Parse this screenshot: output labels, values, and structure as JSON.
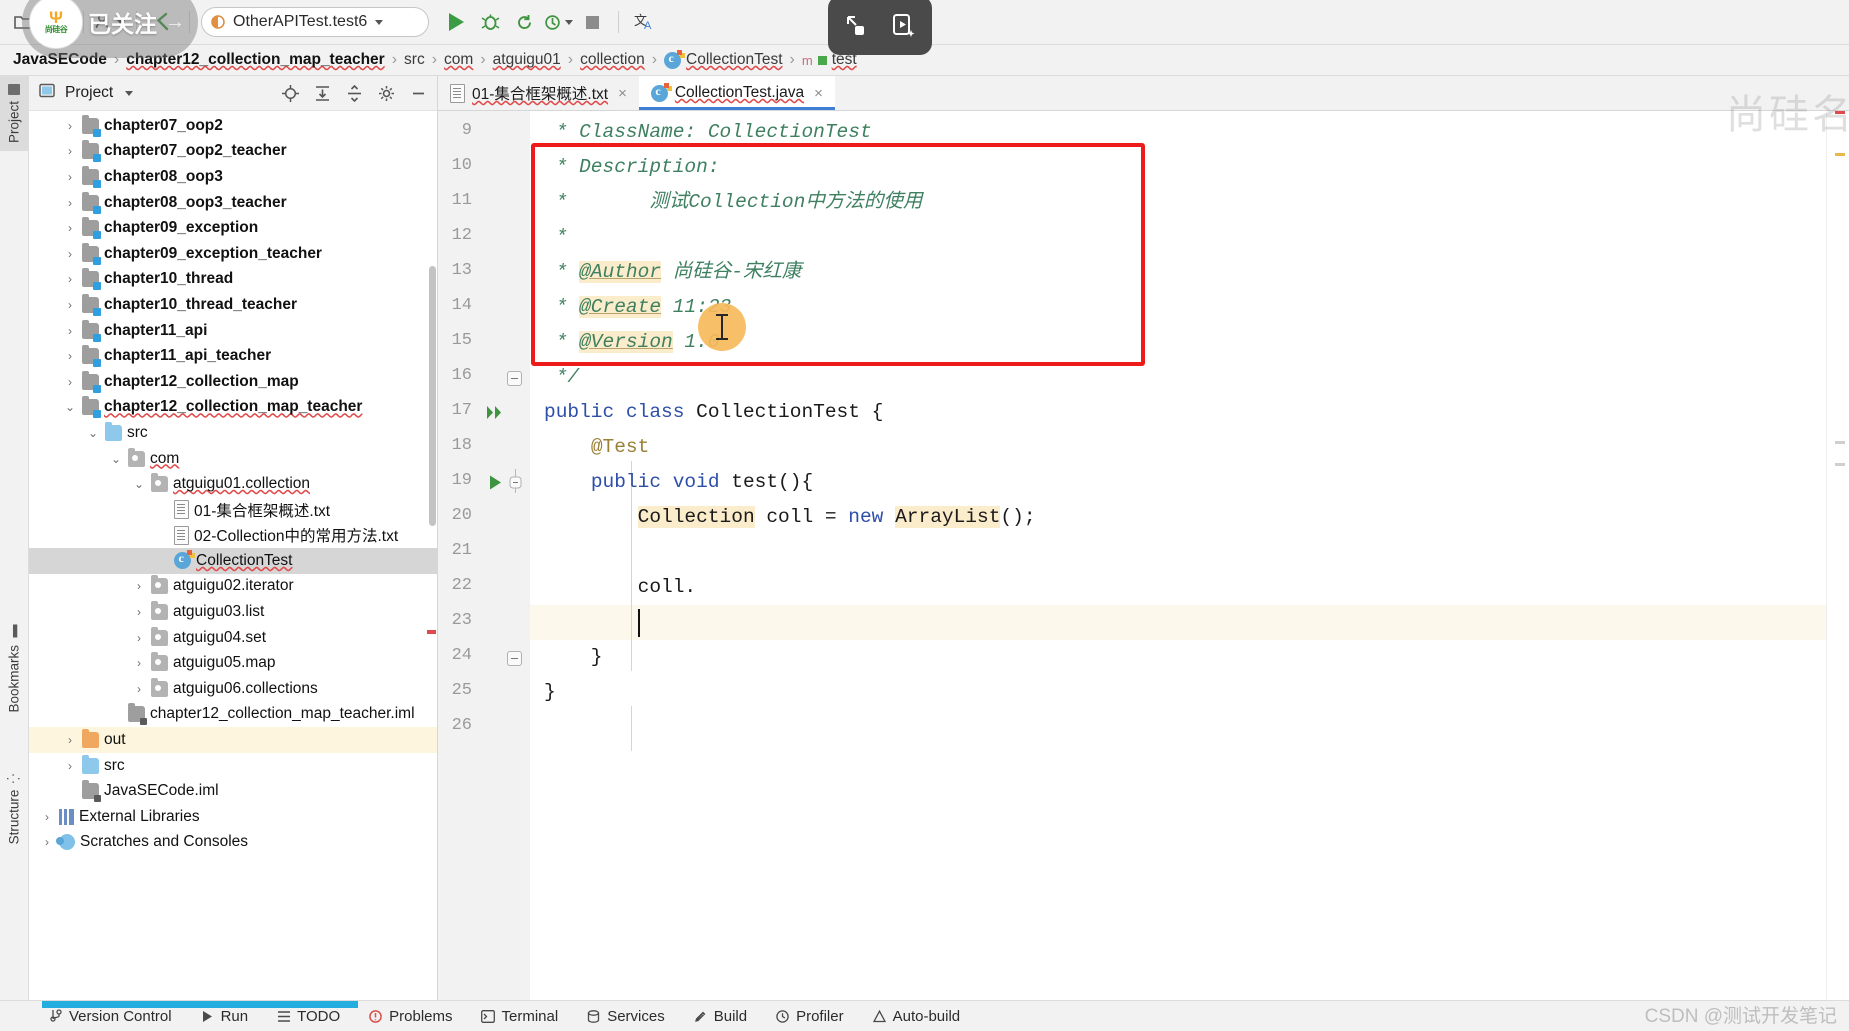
{
  "toolbar": {
    "icons": [
      "project-open-icon",
      "sync-icon",
      "vcs-update-icon",
      "undo-icon"
    ],
    "run_config": {
      "label": "OtherAPITest.test6",
      "icon": "run-config-icon"
    },
    "buttons": [
      "run-button",
      "debug-button",
      "run-with-coverage-button",
      "profiler-button",
      "stop-button",
      "translate-button"
    ],
    "capture_bar": [
      "screenshot-icon",
      "screen-record-icon"
    ],
    "follow_overlay": {
      "text": "已关注",
      "logo_top": "Ψ",
      "logo_bottom": "尚硅谷",
      "arrow": "→"
    }
  },
  "breadcrumbs": [
    {
      "label": "JavaSECode",
      "strong": true,
      "icon": null
    },
    {
      "label": "chapter12_collection_map_teacher",
      "strong": true,
      "icon": null
    },
    {
      "label": "src",
      "strong": false,
      "icon": null
    },
    {
      "label": "com",
      "strong": false,
      "icon": null
    },
    {
      "label": "atguigu01",
      "strong": false,
      "icon": null
    },
    {
      "label": "collection",
      "strong": false,
      "icon": null
    },
    {
      "label": "CollectionTest",
      "strong": false,
      "icon": "java-class-icon"
    },
    {
      "label": "test",
      "strong": false,
      "icon": "method-icon"
    }
  ],
  "rail": {
    "items": [
      {
        "label": "Project",
        "icon": "project-folder-icon",
        "active": true
      },
      {
        "label": "Bookmarks",
        "icon": "bookmark-icon",
        "active": false
      },
      {
        "label": "Structure",
        "icon": "structure-icon",
        "active": false
      }
    ]
  },
  "project_panel": {
    "title": "Project",
    "title_caret": "▾",
    "toolbar_icons": [
      "locate-file-icon",
      "expand-all-icon",
      "collapse-all-icon",
      "settings-gear-icon",
      "hide-panel-icon"
    ],
    "tree": [
      {
        "label": "chapter07_oop2",
        "icon": "module-folder-icon",
        "indent": 1,
        "arrow": "›",
        "bold": true
      },
      {
        "label": "chapter07_oop2_teacher",
        "icon": "module-folder-icon",
        "indent": 1,
        "arrow": "›",
        "bold": true
      },
      {
        "label": "chapter08_oop3",
        "icon": "module-folder-icon",
        "indent": 1,
        "arrow": "›",
        "bold": true
      },
      {
        "label": "chapter08_oop3_teacher",
        "icon": "module-folder-icon",
        "indent": 1,
        "arrow": "›",
        "bold": true
      },
      {
        "label": "chapter09_exception",
        "icon": "module-folder-icon",
        "indent": 1,
        "arrow": "›",
        "bold": true
      },
      {
        "label": "chapter09_exception_teacher",
        "icon": "module-folder-icon",
        "indent": 1,
        "arrow": "›",
        "bold": true
      },
      {
        "label": "chapter10_thread",
        "icon": "module-folder-icon",
        "indent": 1,
        "arrow": "›",
        "bold": true
      },
      {
        "label": "chapter10_thread_teacher",
        "icon": "module-folder-icon",
        "indent": 1,
        "arrow": "›",
        "bold": true
      },
      {
        "label": "chapter11_api",
        "icon": "module-folder-icon",
        "indent": 1,
        "arrow": "›",
        "bold": true
      },
      {
        "label": "chapter11_api_teacher",
        "icon": "module-folder-icon",
        "indent": 1,
        "arrow": "›",
        "bold": true
      },
      {
        "label": "chapter12_collection_map",
        "icon": "module-folder-icon",
        "indent": 1,
        "arrow": "›",
        "bold": true
      },
      {
        "label": "chapter12_collection_map_teacher",
        "icon": "module-folder-icon",
        "indent": 1,
        "arrow": "⌄",
        "bold": true,
        "squiggly": true
      },
      {
        "label": "src",
        "icon": "source-folder-icon",
        "indent": 2,
        "arrow": "⌄",
        "bold": false
      },
      {
        "label": "com",
        "icon": "package-folder-icon",
        "indent": 3,
        "arrow": "⌄",
        "bold": false,
        "squiggly": true
      },
      {
        "label": "atguigu01.collection",
        "icon": "package-folder-icon",
        "indent": 4,
        "arrow": "⌄",
        "bold": false,
        "squiggly": true
      },
      {
        "label": "01-集合框架概述.txt",
        "icon": "text-file-icon",
        "indent": 5,
        "arrow": "",
        "bold": false
      },
      {
        "label": "02-Collection中的常用方法.txt",
        "icon": "text-file-icon",
        "indent": 5,
        "arrow": "",
        "bold": false
      },
      {
        "label": "CollectionTest",
        "icon": "java-class-icon",
        "indent": 5,
        "arrow": "",
        "bold": false,
        "selected": true,
        "squiggly": true
      },
      {
        "label": "atguigu02.iterator",
        "icon": "package-folder-icon",
        "indent": 4,
        "arrow": "›",
        "bold": false
      },
      {
        "label": "atguigu03.list",
        "icon": "package-folder-icon",
        "indent": 4,
        "arrow": "›",
        "bold": false
      },
      {
        "label": "atguigu04.set",
        "icon": "package-folder-icon",
        "indent": 4,
        "arrow": "›",
        "bold": false
      },
      {
        "label": "atguigu05.map",
        "icon": "package-folder-icon",
        "indent": 4,
        "arrow": "›",
        "bold": false
      },
      {
        "label": "atguigu06.collections",
        "icon": "package-folder-icon",
        "indent": 4,
        "arrow": "›",
        "bold": false
      },
      {
        "label": "chapter12_collection_map_teacher.iml",
        "icon": "iml-file-icon",
        "indent": 3,
        "arrow": "",
        "bold": false
      },
      {
        "label": "out",
        "icon": "out-folder-icon",
        "indent": 1,
        "arrow": "›",
        "bold": false,
        "highlight": true
      },
      {
        "label": "src",
        "icon": "source-folder-icon",
        "indent": 1,
        "arrow": "›",
        "bold": false
      },
      {
        "label": "JavaSECode.iml",
        "icon": "iml-file-icon",
        "indent": 1,
        "arrow": "",
        "bold": false
      },
      {
        "label": "External Libraries",
        "icon": "libraries-icon",
        "indent": 0,
        "arrow": "›",
        "bold": false
      },
      {
        "label": "Scratches and Consoles",
        "icon": "scratches-icon",
        "indent": 0,
        "arrow": "›",
        "bold": false
      }
    ]
  },
  "editor": {
    "tabs": [
      {
        "label": "01-集合框架概述.txt",
        "icon": "text-file-icon",
        "active": false,
        "close": "×"
      },
      {
        "label": "CollectionTest.java",
        "icon": "java-class-icon",
        "active": true,
        "close": "×"
      }
    ],
    "lines": [
      {
        "num": "9",
        "parts": [
          {
            "t": " * ClassName: CollectionTest",
            "c": "cmt"
          }
        ]
      },
      {
        "num": "10",
        "parts": [
          {
            "t": " * Description:",
            "c": "cmt"
          }
        ]
      },
      {
        "num": "11",
        "parts": [
          {
            "t": " *       测试Collection中方法的使用",
            "c": "cmt"
          }
        ]
      },
      {
        "num": "12",
        "parts": [
          {
            "t": " *",
            "c": "cmt"
          }
        ]
      },
      {
        "num": "13",
        "parts": [
          {
            "t": " * ",
            "c": "cmt"
          },
          {
            "t": "@Author",
            "c": "cmt hl-u"
          },
          {
            "t": " 尚硅谷-宋红康",
            "c": "cmt"
          }
        ]
      },
      {
        "num": "14",
        "parts": [
          {
            "t": " * ",
            "c": "cmt"
          },
          {
            "t": "@Create",
            "c": "cmt hl-u"
          },
          {
            "t": " 11:23",
            "c": "cmt"
          }
        ]
      },
      {
        "num": "15",
        "parts": [
          {
            "t": " * ",
            "c": "cmt"
          },
          {
            "t": "@Version",
            "c": "cmt hl-u"
          },
          {
            "t": " 1.0",
            "c": "cmt"
          }
        ]
      },
      {
        "num": "16",
        "parts": [
          {
            "t": " */",
            "c": "cmt"
          }
        ],
        "fold": "end"
      },
      {
        "num": "17",
        "parts": [
          {
            "t": "public class ",
            "c": "kw"
          },
          {
            "t": "CollectionTest {",
            "c": "ident"
          }
        ],
        "gutter": "run-all-tests-icon"
      },
      {
        "num": "18",
        "parts": [
          {
            "t": "    ",
            "c": "ident"
          },
          {
            "t": "@Test",
            "c": "anno"
          }
        ]
      },
      {
        "num": "19",
        "parts": [
          {
            "t": "    ",
            "c": "ident"
          },
          {
            "t": "public void ",
            "c": "kw"
          },
          {
            "t": "test(){",
            "c": "ident"
          }
        ],
        "gutter": "run-test-icon",
        "fold": "open"
      },
      {
        "num": "20",
        "parts": [
          {
            "t": "        ",
            "c": "ident"
          },
          {
            "t": "Collection",
            "c": "ident hl"
          },
          {
            "t": " coll = ",
            "c": "ident"
          },
          {
            "t": "new ",
            "c": "kw"
          },
          {
            "t": "ArrayList",
            "c": "ident hl"
          },
          {
            "t": "();",
            "c": "ident"
          }
        ]
      },
      {
        "num": "21",
        "parts": [
          {
            "t": "",
            "c": "ident"
          }
        ]
      },
      {
        "num": "22",
        "parts": [
          {
            "t": "        coll.",
            "c": "ident"
          }
        ]
      },
      {
        "num": "23",
        "parts": [
          {
            "t": "        ",
            "c": "ident"
          }
        ],
        "current": true
      },
      {
        "num": "24",
        "parts": [
          {
            "t": "    }",
            "c": "ident"
          }
        ],
        "fold": "end"
      },
      {
        "num": "25",
        "parts": [
          {
            "t": "}",
            "c": "ident"
          }
        ]
      },
      {
        "num": "26",
        "parts": [
          {
            "t": "",
            "c": "ident"
          }
        ]
      }
    ]
  },
  "bottom_bar": {
    "items": [
      {
        "label": "Version Control",
        "icon": "vcs-icon"
      },
      {
        "label": "Run",
        "icon": "run-icon"
      },
      {
        "label": "TODO",
        "icon": "todo-icon"
      },
      {
        "label": "Problems",
        "icon": "problems-icon"
      },
      {
        "label": "Terminal",
        "icon": "terminal-icon"
      },
      {
        "label": "Services",
        "icon": "services-icon"
      },
      {
        "label": "Build",
        "icon": "build-icon"
      },
      {
        "label": "Profiler",
        "icon": "profiler-icon"
      },
      {
        "label": "Auto-build",
        "icon": "auto-build-icon"
      }
    ]
  },
  "watermarks": {
    "top_right": "尚硅名",
    "bottom_right": "CSDN @测试开发笔记"
  },
  "colors": {
    "accent_blue": "#3e7fd5",
    "run_green": "#3c9c43",
    "highlight_red": "#ee1b1b",
    "token_highlight": "#fbeccb",
    "comment_green": "#3f8060",
    "keyword_blue": "#2e4fa8",
    "cursor_halo": "#f7ba5c"
  }
}
